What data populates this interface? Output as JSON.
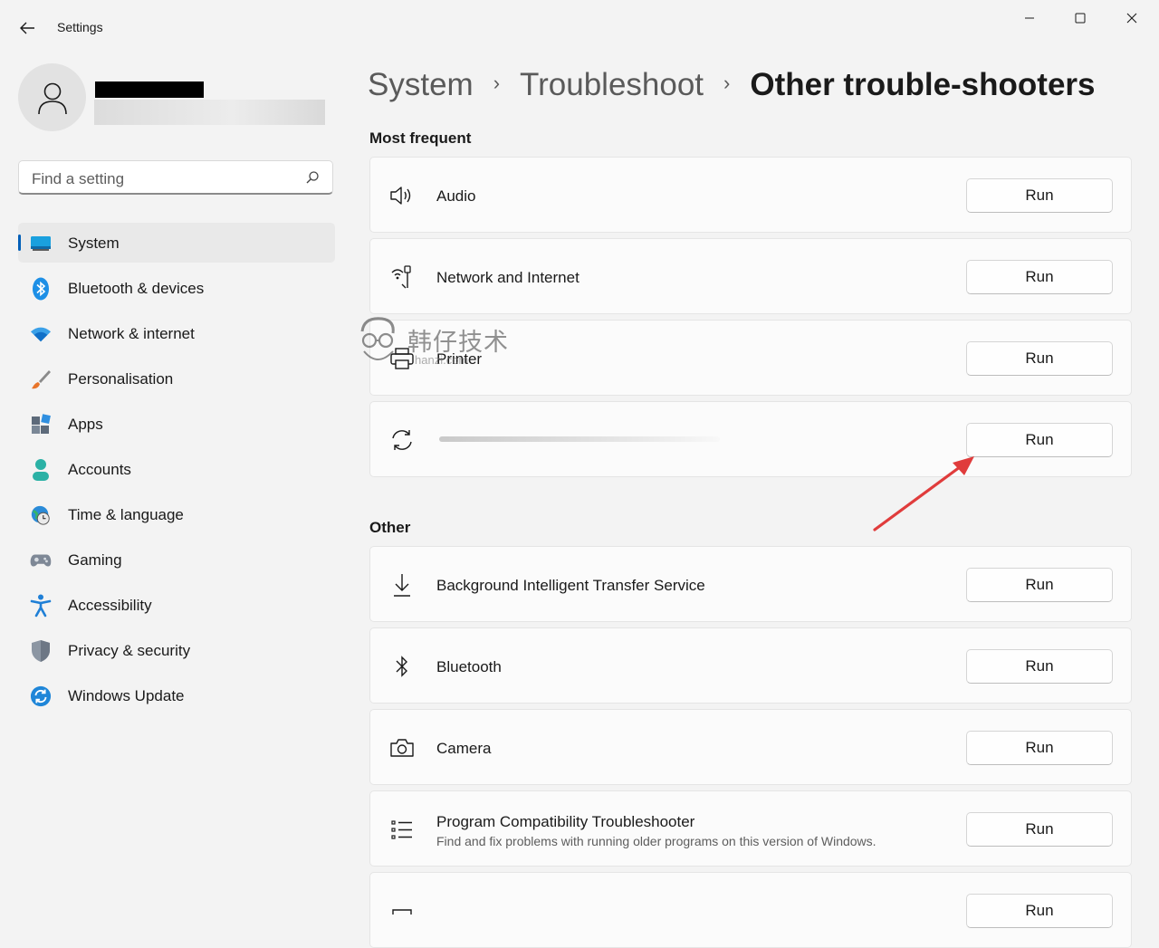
{
  "window": {
    "title": "Settings"
  },
  "user": {
    "name": "■■■■■■■",
    "email": ""
  },
  "search": {
    "placeholder": "Find a setting"
  },
  "sidebar": {
    "items": [
      {
        "label": "System",
        "icon": "system-monitor-icon",
        "active": true
      },
      {
        "label": "Bluetooth & devices",
        "icon": "bluetooth-icon"
      },
      {
        "label": "Network & internet",
        "icon": "wifi-icon"
      },
      {
        "label": "Personalisation",
        "icon": "paintbrush-icon"
      },
      {
        "label": "Apps",
        "icon": "apps-icon"
      },
      {
        "label": "Accounts",
        "icon": "accounts-icon"
      },
      {
        "label": "Time & language",
        "icon": "globe-clock-icon"
      },
      {
        "label": "Gaming",
        "icon": "gamepad-icon"
      },
      {
        "label": "Accessibility",
        "icon": "accessibility-icon"
      },
      {
        "label": "Privacy & security",
        "icon": "shield-icon"
      },
      {
        "label": "Windows Update",
        "icon": "windows-update-icon"
      }
    ]
  },
  "breadcrumb": [
    "System",
    "Troubleshoot",
    "Other trouble-shooters"
  ],
  "sections": {
    "most_frequent": "Most frequent",
    "other": "Other"
  },
  "troubleshooters": {
    "audio": {
      "title": "Audio",
      "button": "Run",
      "icon": "speaker-icon"
    },
    "network": {
      "title": "Network and Internet",
      "button": "Run",
      "icon": "network-antenna-icon"
    },
    "printer": {
      "title": "Printer",
      "button": "Run",
      "icon": "printer-icon"
    },
    "windows_update": {
      "title": "",
      "button": "Run",
      "icon": "sync-icon"
    },
    "bits": {
      "title": "Background Intelligent Transfer Service",
      "button": "Run",
      "icon": "download-icon"
    },
    "bluetooth": {
      "title": "Bluetooth",
      "button": "Run",
      "icon": "bluetooth-icon"
    },
    "camera": {
      "title": "Camera",
      "button": "Run",
      "icon": "camera-icon"
    },
    "program_compat": {
      "title": "Program Compatibility Troubleshooter",
      "description": "Find and fix problems with running older programs on this version of Windows.",
      "button": "Run",
      "icon": "list-icon"
    },
    "next": {
      "button": "Run"
    }
  },
  "watermark": {
    "text": "韩仔技术",
    "url": "hanzi.com"
  },
  "colors": {
    "accent": "#005fb8",
    "annotation_arrow": "#e03c3c"
  }
}
